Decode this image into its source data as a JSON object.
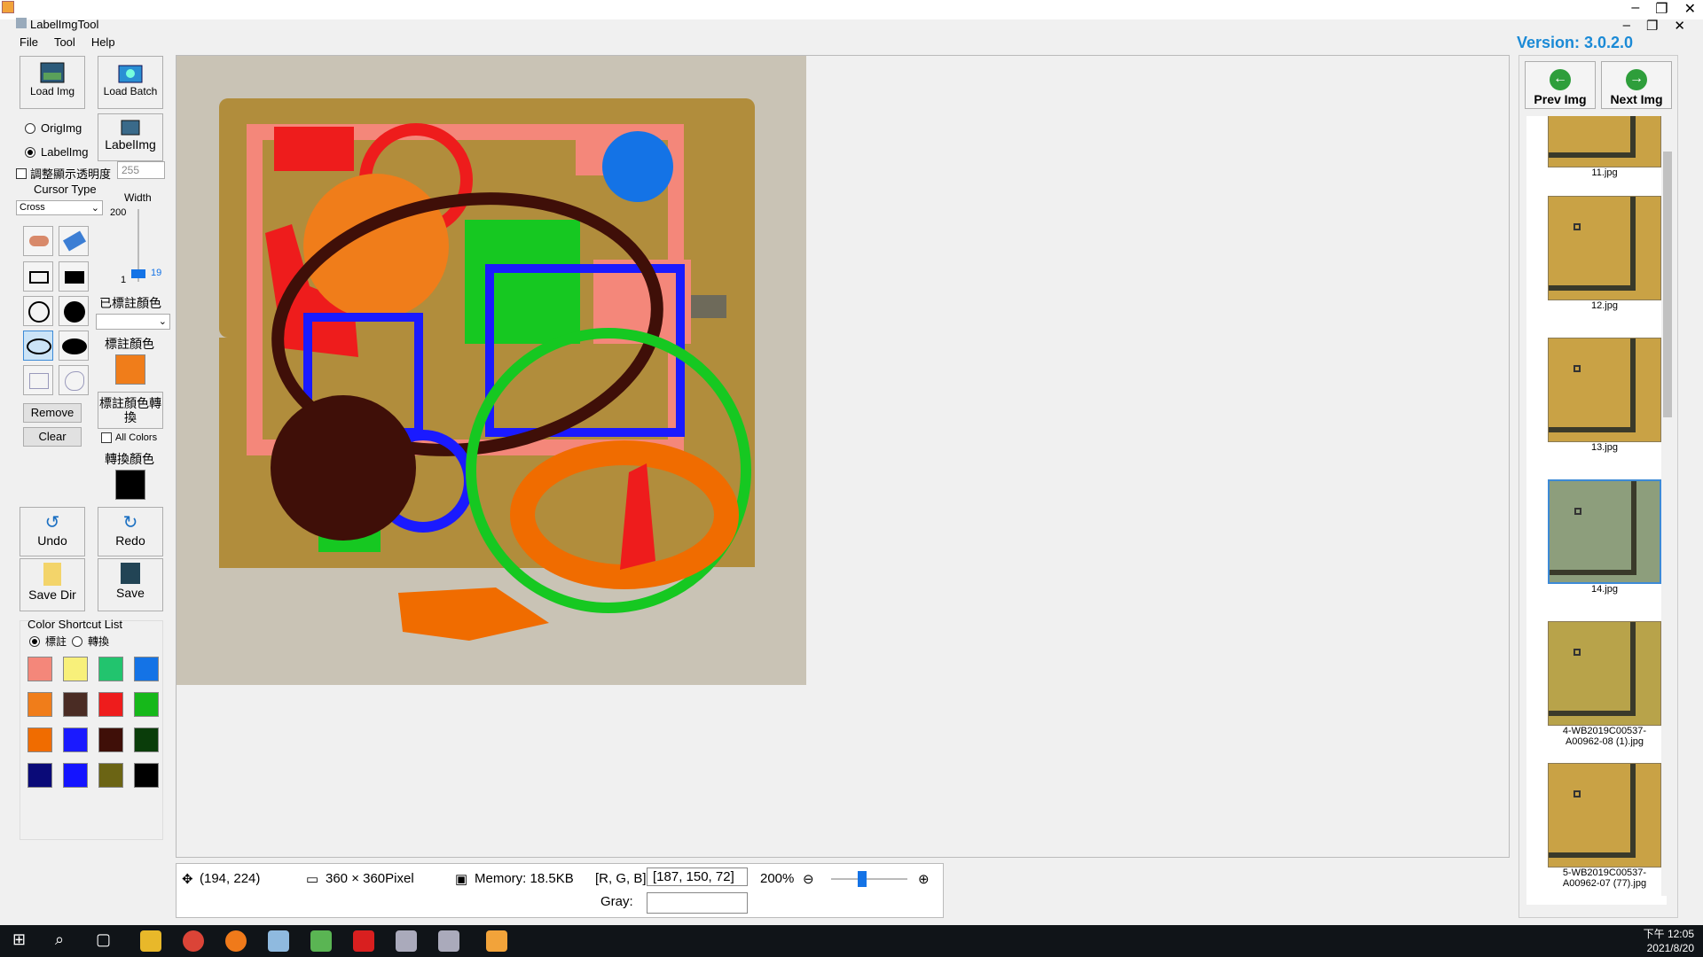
{
  "window": {
    "title": "LabelImgTool",
    "version": "Version: 3.0.2.0"
  },
  "menu": [
    "File",
    "Tool",
    "Help"
  ],
  "toolbar": {
    "load_img": "Load Img",
    "load_batch": "Load Batch",
    "orig_img": "OrigImg",
    "label_img_radio": "LabelImg",
    "label_img_btn": "LabelImg",
    "transparency_label": "調整顯示透明度",
    "transparency_value": "255",
    "cursor_type_label": "Cursor Type",
    "cursor_type_value": "Cross",
    "width_label": "Width",
    "width_max": "200",
    "width_min": "1",
    "width_value": "19",
    "labeled_color_label": "已標註顏色",
    "label_color_label": "標註顏色",
    "convert_btn": "標註顏色轉換",
    "all_colors": "All Colors",
    "convert_color_label": "轉換顏色",
    "remove": "Remove",
    "clear": "Clear",
    "undo": "Undo",
    "redo": "Redo",
    "save_dir": "Save Dir",
    "save": "Save"
  },
  "palette": {
    "title": "Color Shortcut List",
    "mode_label": "標註",
    "mode_convert": "轉換",
    "colors": [
      "#f4877a",
      "#f8f07a",
      "#22c46e",
      "#1473e6",
      "#f07d1a",
      "#4a2c24",
      "#ee1c1c",
      "#16b81a",
      "#f06c00",
      "#1a1aff",
      "#3f0f08",
      "#0a3d0a",
      "#0a0a78",
      "#1414ff",
      "#6b6414",
      "#000000"
    ]
  },
  "label_color": "#f07d1a",
  "convert_color": "#000000",
  "status": {
    "coords": "(194, 224)",
    "size": "360 × 360Pixel",
    "memory": "Memory: 18.5KB",
    "rgb_label": "[R, G, B]:",
    "rgb_value": "[187, 150, 72]",
    "gray_label": "Gray:",
    "zoom": "200%"
  },
  "nav": {
    "prev": "Prev Img",
    "next": "Next Img"
  },
  "thumbnails": [
    "11.jpg",
    "12.jpg",
    "13.jpg",
    "14.jpg",
    "4-WB2019C00537-A00962-08 (1).jpg",
    "5-WB2019C00537-A00962-07 (77).jpg"
  ],
  "clock": {
    "time": "下午 12:05",
    "date": "2021/8/20"
  }
}
